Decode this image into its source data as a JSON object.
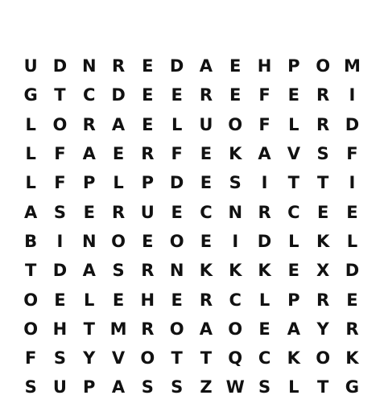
{
  "word_search": {
    "grid": [
      [
        "U",
        "D",
        "N",
        "R",
        "E",
        "D",
        "A",
        "E",
        "H",
        "P",
        "O",
        "M"
      ],
      [
        "G",
        "T",
        "C",
        "D",
        "E",
        "E",
        "R",
        "E",
        "F",
        "E",
        "R",
        "I"
      ],
      [
        "L",
        "O",
        "R",
        "A",
        "E",
        "L",
        "U",
        "O",
        "F",
        "L",
        "R",
        "D"
      ],
      [
        "L",
        "F",
        "A",
        "E",
        "R",
        "F",
        "E",
        "K",
        "A",
        "V",
        "S",
        "F"
      ],
      [
        "L",
        "F",
        "P",
        "L",
        "P",
        "D",
        "E",
        "S",
        "I",
        "T",
        "T",
        "I"
      ],
      [
        "A",
        "S",
        "E",
        "R",
        "U",
        "E",
        "C",
        "N",
        "R",
        "C",
        "E",
        "E"
      ],
      [
        "B",
        "I",
        "N",
        "O",
        "E",
        "O",
        "E",
        "I",
        "D",
        "L",
        "K",
        "L"
      ],
      [
        "T",
        "D",
        "A",
        "S",
        "R",
        "N",
        "K",
        "K",
        "K",
        "E",
        "X",
        "D"
      ],
      [
        "O",
        "E",
        "L",
        "E",
        "H",
        "E",
        "R",
        "C",
        "L",
        "P",
        "R",
        "E"
      ],
      [
        "O",
        "H",
        "T",
        "M",
        "R",
        "O",
        "A",
        "O",
        "E",
        "A",
        "Y",
        "R"
      ],
      [
        "F",
        "S",
        "Y",
        "V",
        "O",
        "T",
        "T",
        "Q",
        "C",
        "K",
        "O",
        "K"
      ],
      [
        "S",
        "U",
        "P",
        "A",
        "S",
        "S",
        "Z",
        "W",
        "S",
        "L",
        "T",
        "G"
      ]
    ],
    "text_color": "#111111",
    "background_color": "#ffffff"
  }
}
